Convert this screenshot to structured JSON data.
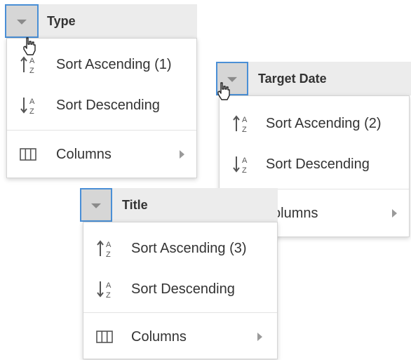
{
  "panels": [
    {
      "header": "Type",
      "sort_ascending": "Sort Ascending (1)",
      "sort_descending": "Sort Descending",
      "columns": "Columns"
    },
    {
      "header": "Target Date",
      "sort_ascending": "Sort Ascending (2)",
      "sort_descending": "Sort Descending",
      "columns": "olumns"
    },
    {
      "header": "Title",
      "sort_ascending": "Sort Ascending (3)",
      "sort_descending": "Sort Descending",
      "columns": "Columns"
    }
  ],
  "icons": {
    "dropdown": "chevron-down-icon",
    "sort_ascending": "sort-ascending-icon",
    "sort_descending": "sort-descending-icon",
    "columns": "columns-icon",
    "submenu": "chevron-right-icon",
    "cursor": "hand-cursor-icon"
  },
  "colors": {
    "header_bg": "#ececec",
    "button_bg": "#d6d6d6",
    "button_border": "#4a8fd6",
    "text": "#333333",
    "menu_border": "#d4d4d4"
  }
}
